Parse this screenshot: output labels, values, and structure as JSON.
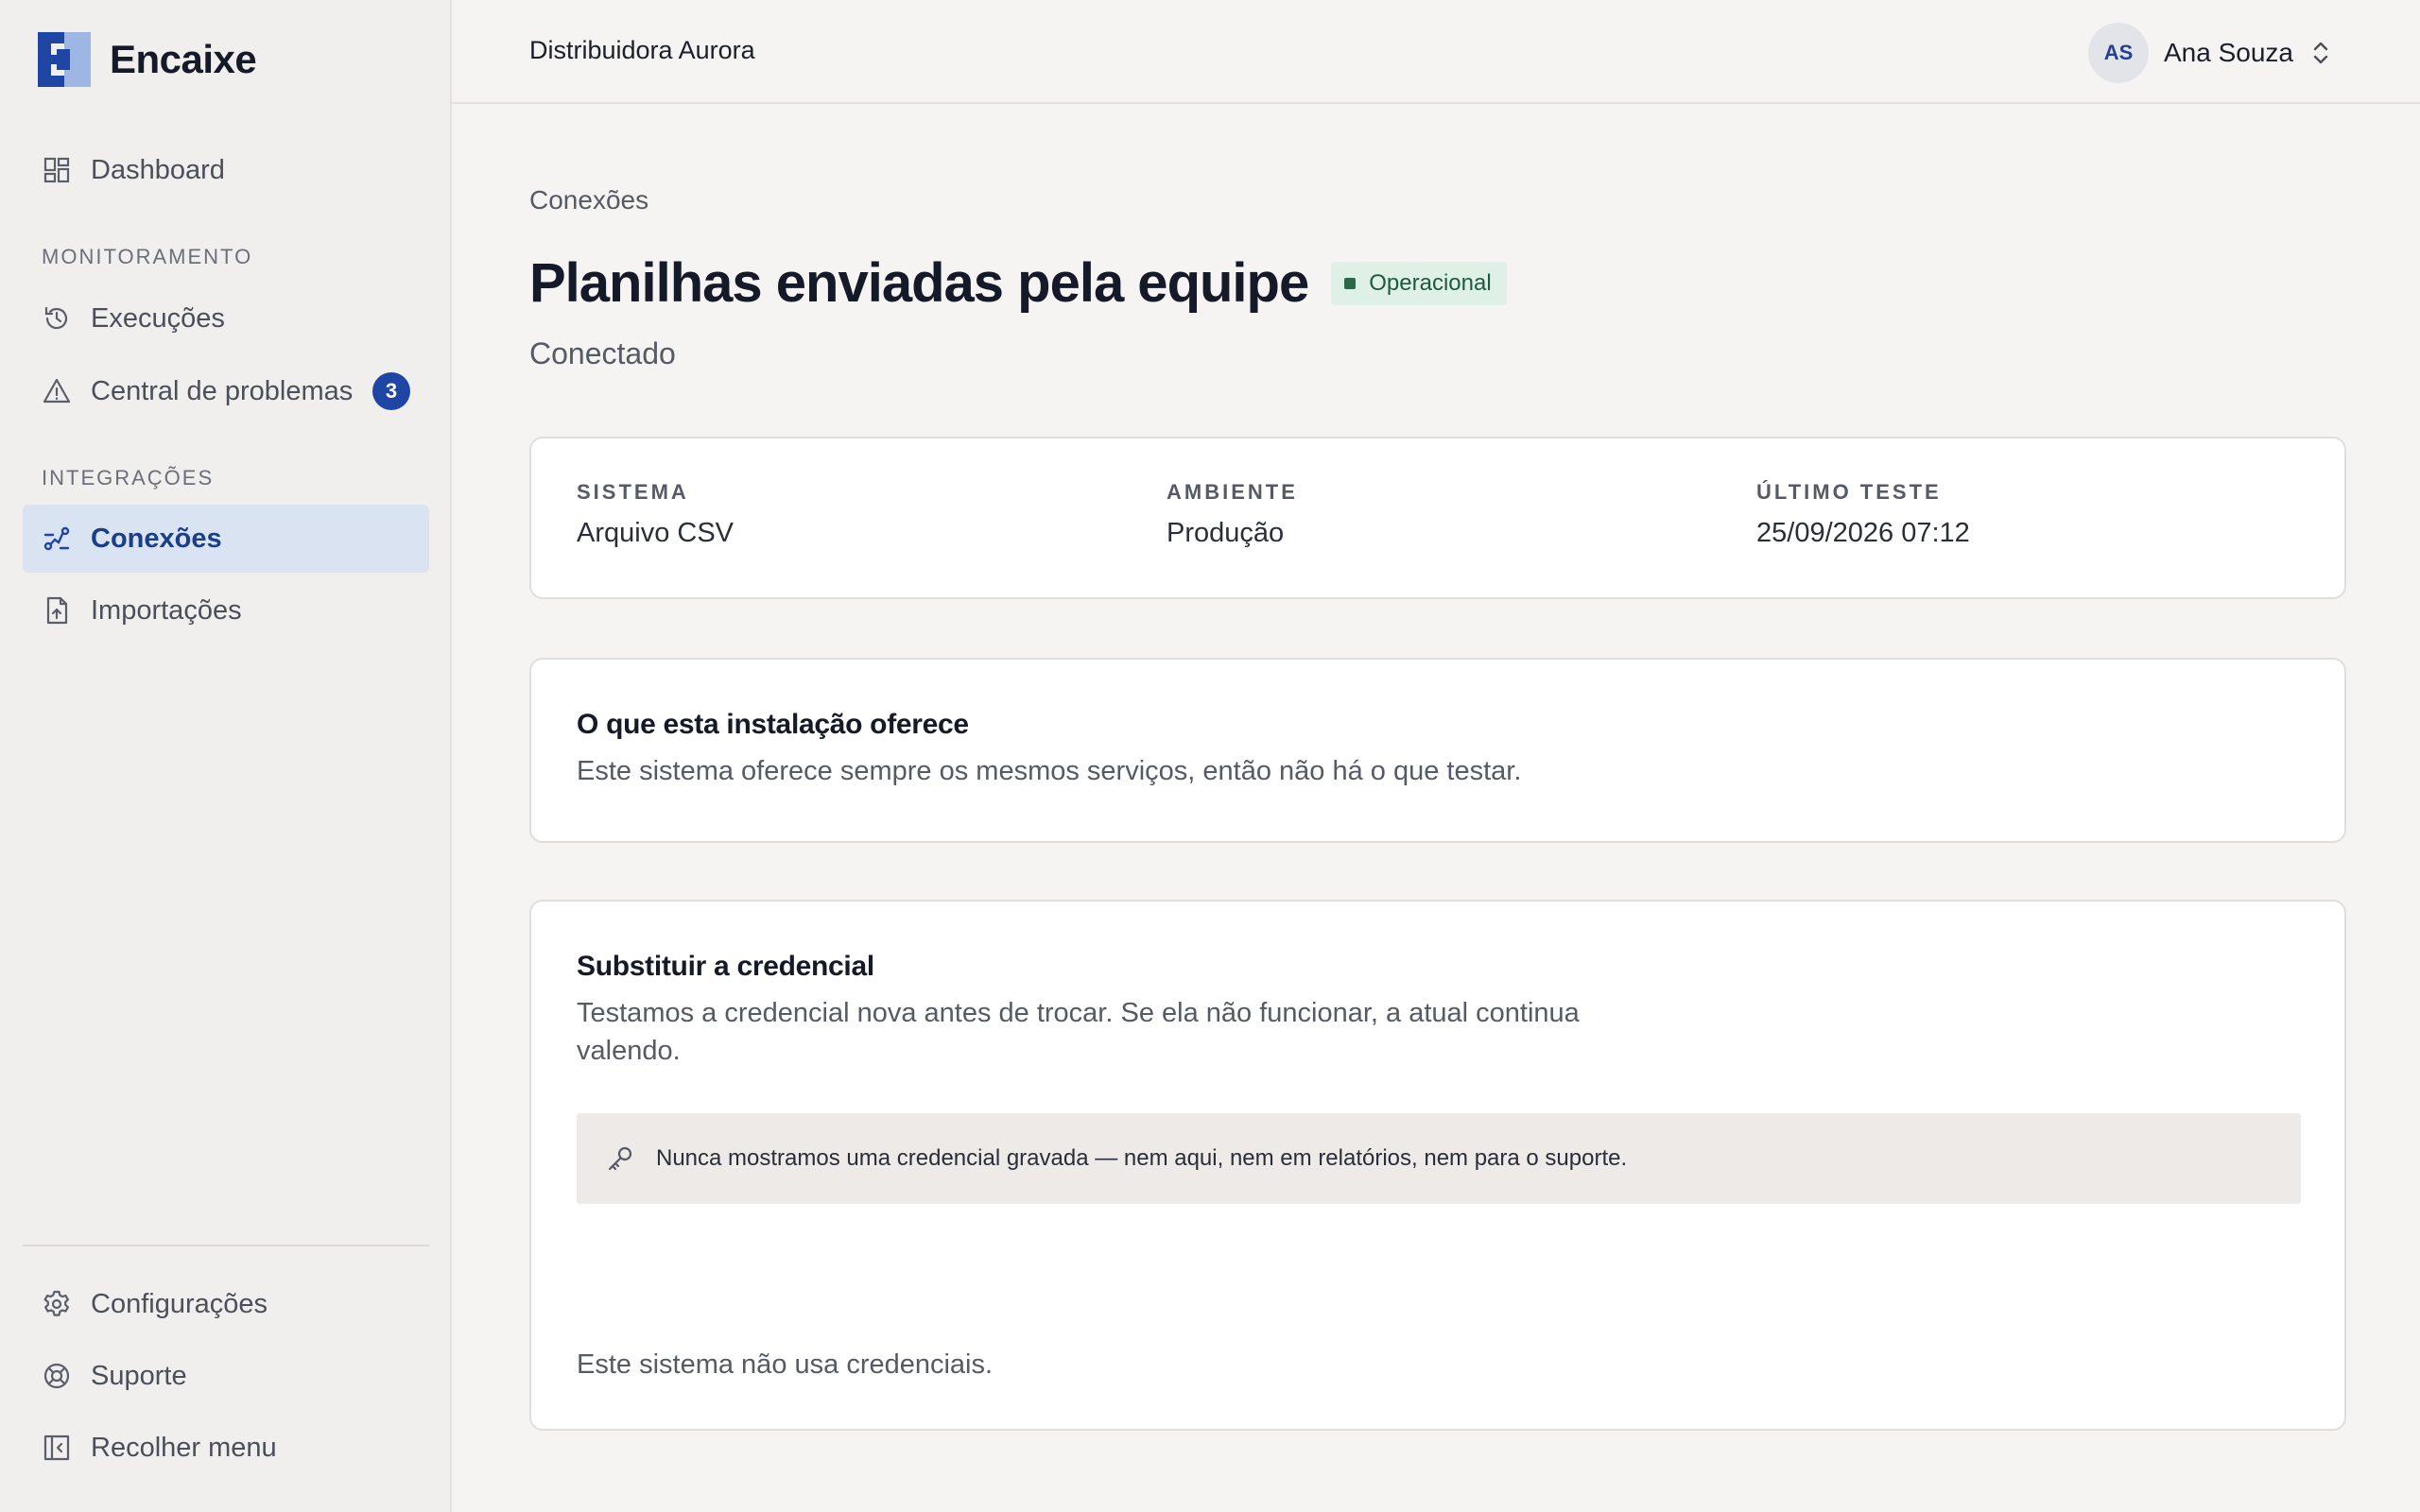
{
  "app": {
    "name": "Encaixe"
  },
  "sidebar": {
    "dashboard": {
      "label": "Dashboard",
      "icon": "dashboard-grid-icon"
    },
    "sections": [
      {
        "label": "MONITORAMENTO",
        "items": [
          {
            "label": "Execuções",
            "icon": "history-icon"
          },
          {
            "label": "Central de problemas",
            "icon": "warning-icon",
            "badge": "3"
          }
        ]
      },
      {
        "label": "INTEGRAÇÕES",
        "items": [
          {
            "label": "Conexões",
            "icon": "connections-icon",
            "active": true
          },
          {
            "label": "Importações",
            "icon": "file-upload-icon"
          }
        ]
      }
    ],
    "footer": [
      {
        "label": "Configurações",
        "icon": "gear-icon"
      },
      {
        "label": "Suporte",
        "icon": "lifebuoy-icon"
      },
      {
        "label": "Recolher menu",
        "icon": "collapse-sidebar-icon"
      }
    ]
  },
  "header": {
    "organization": "Distribuidora Aurora",
    "user": {
      "initials": "AS",
      "name": "Ana Souza"
    }
  },
  "page": {
    "breadcrumb": "Conexões",
    "title": "Planilhas enviadas pela equipe",
    "status": "Operacional",
    "subtitle": "Conectado",
    "meta": [
      {
        "key": "SISTEMA",
        "value": "Arquivo CSV"
      },
      {
        "key": "AMBIENTE",
        "value": "Produção"
      },
      {
        "key": "ÚLTIMO TESTE",
        "value": "25/09/2026 07:12"
      }
    ],
    "offer": {
      "title": "O que esta instalação oferece",
      "text": "Este sistema oferece sempre os mesmos serviços, então não há o que testar."
    },
    "credential": {
      "title": "Substituir a credencial",
      "text_line1": "Testamos a credencial nova antes de trocar. Se ela não funcionar, a atual continua",
      "text_line2": "valendo.",
      "notice": "Nunca mostramos uma credencial gravada — nem aqui, nem em relatórios, nem para o suporte.",
      "empty": "Este sistema não usa credenciais."
    }
  },
  "colors": {
    "accent": "#1f46a4",
    "active_bg": "#d9e3f2",
    "status_bg": "#dff0e6",
    "status_fg": "#1f5a3c"
  }
}
